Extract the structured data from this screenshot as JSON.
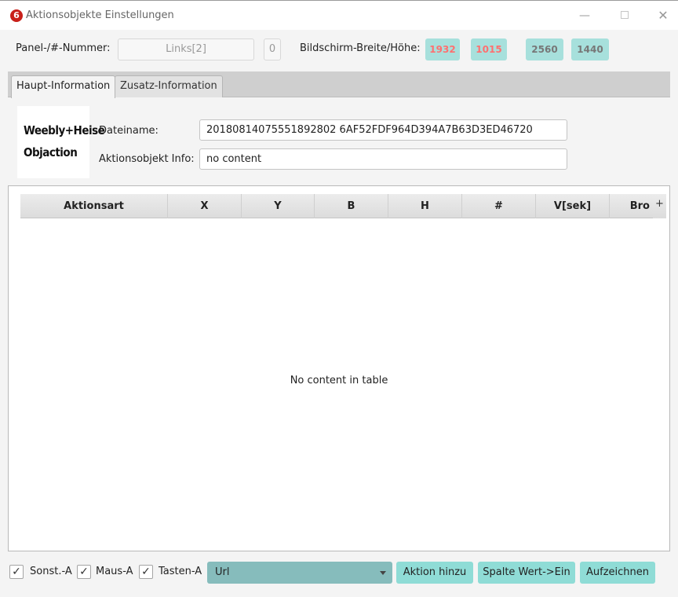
{
  "window": {
    "logo_glyph": "6",
    "title": "Aktionsobjekte Einstellungen",
    "controls": {
      "minimize": "—",
      "close": "✕"
    }
  },
  "info_row": {
    "panel_label": "Panel-/#-Nummer:",
    "panel_value": "Links[2]",
    "panel_number": "0",
    "screen_label": "Bildschirm-Breite/Höhe:",
    "screen_width": "1932",
    "screen_height": "1015",
    "max_width": "2560",
    "max_height": "1440"
  },
  "tabs": [
    {
      "label": "Haupt-Information",
      "active": true
    },
    {
      "label": "Zusatz-Information",
      "active": false
    }
  ],
  "main": {
    "logo_line1": "Weebly+Heise",
    "logo_line2": "Objaction",
    "filename_label": "Dateiname:",
    "filename_value": "20180814075551892802 6AF52FDF964D394A7B63D3ED46720",
    "info_label": "Aktionsobjekt Info:",
    "info_value": "no content"
  },
  "table": {
    "columns": [
      "Aktionsart",
      "X",
      "Y",
      "B",
      "H",
      "#",
      "V[sek]",
      "Bro"
    ],
    "add_column_glyph": "+",
    "empty_message": "No content in table"
  },
  "bottom": {
    "checkboxes": [
      {
        "label": "Sonst.-A",
        "checked": true
      },
      {
        "label": "Maus-A",
        "checked": true
      },
      {
        "label": "Tasten-A",
        "checked": true
      }
    ],
    "check_glyph": "✓",
    "combo_value": "Url",
    "buttons": [
      "Aktion hinzu",
      "Spalte Wert->Ein",
      "Aufzeichnen"
    ]
  },
  "colors": {
    "accent": "#8fdcd6",
    "combo": "#86bcbc",
    "highlight_text": "#ff7070",
    "logo_red": "#c8201a"
  }
}
